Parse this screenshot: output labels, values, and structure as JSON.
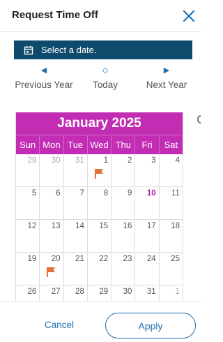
{
  "dialog": {
    "title": "Request Time Off",
    "close_icon": "close-icon"
  },
  "banner": {
    "icon": "calendar-icon",
    "text": "Select a date."
  },
  "nav": {
    "previous": {
      "icon": "triangle-left-icon",
      "label": "Previous Year"
    },
    "today": {
      "icon": "diamond-icon",
      "label": "Today"
    },
    "next": {
      "icon": "triangle-right-icon",
      "label": "Next Year"
    }
  },
  "calendar": {
    "title": "January 2025",
    "weekdays": [
      "Sun",
      "Mon",
      "Tue",
      "Wed",
      "Thu",
      "Fri",
      "Sat"
    ],
    "weeks": [
      [
        {
          "d": "29",
          "other": true
        },
        {
          "d": "30",
          "other": true
        },
        {
          "d": "31",
          "other": true
        },
        {
          "d": "1",
          "flag": true
        },
        {
          "d": "2"
        },
        {
          "d": "3"
        },
        {
          "d": "4"
        }
      ],
      [
        {
          "d": "5"
        },
        {
          "d": "6"
        },
        {
          "d": "7"
        },
        {
          "d": "8"
        },
        {
          "d": "9"
        },
        {
          "d": "10",
          "today": true
        },
        {
          "d": "11"
        }
      ],
      [
        {
          "d": "12"
        },
        {
          "d": "13"
        },
        {
          "d": "14"
        },
        {
          "d": "15"
        },
        {
          "d": "16"
        },
        {
          "d": "17"
        },
        {
          "d": "18"
        }
      ],
      [
        {
          "d": "19"
        },
        {
          "d": "20",
          "flag": true
        },
        {
          "d": "21"
        },
        {
          "d": "22"
        },
        {
          "d": "23"
        },
        {
          "d": "24"
        },
        {
          "d": "25"
        }
      ],
      [
        {
          "d": "26"
        },
        {
          "d": "27"
        },
        {
          "d": "28"
        },
        {
          "d": "29"
        },
        {
          "d": "30"
        },
        {
          "d": "31"
        },
        {
          "d": "1",
          "other": true
        }
      ]
    ],
    "flag_icon": "holiday-flag-icon"
  },
  "footer": {
    "cancel_label": "Cancel",
    "apply_label": "Apply"
  },
  "colors": {
    "banner": "#0d4a6b",
    "calendar_header": "#c22db4",
    "today": "#b0209e",
    "flag": "#e0703a",
    "link": "#1f6fae"
  }
}
